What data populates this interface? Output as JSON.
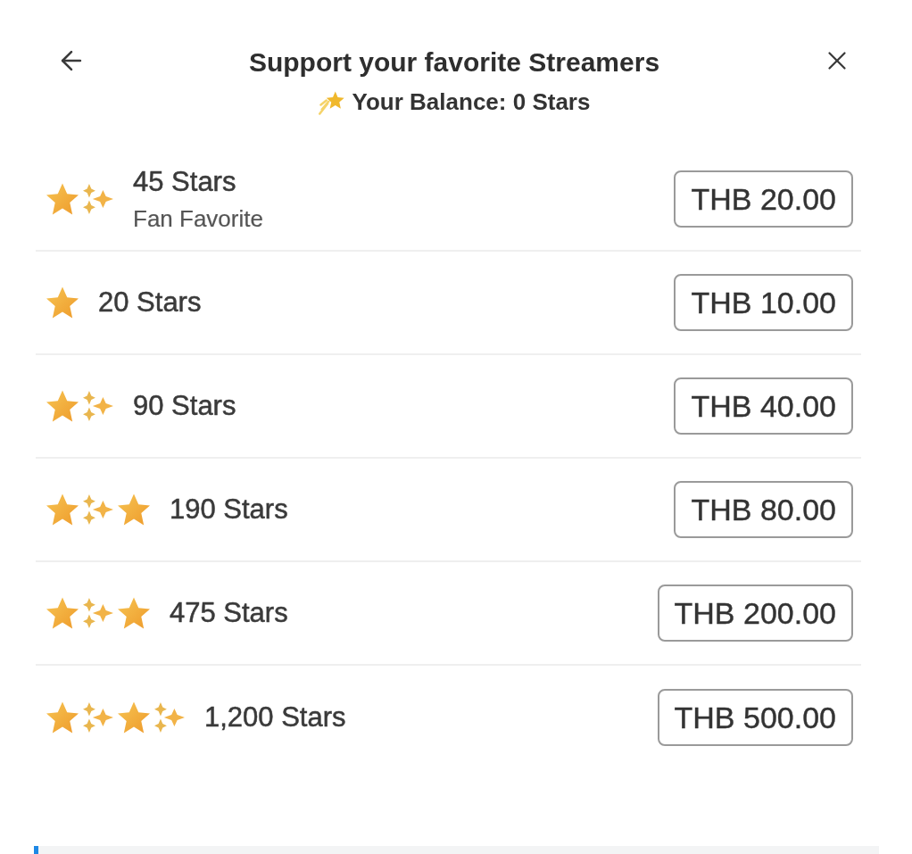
{
  "header": {
    "title": "Support your favorite Streamers",
    "balance": "Your Balance: 0 Stars"
  },
  "packages": [
    {
      "label": "45 Stars",
      "subtitle": "Fan Favorite",
      "price": "THB 20.00",
      "icons": [
        {
          "kind": "star"
        },
        {
          "kind": "sparkle"
        }
      ]
    },
    {
      "label": "20 Stars",
      "price": "THB 10.00",
      "icons": [
        {
          "kind": "star"
        }
      ]
    },
    {
      "label": "90 Stars",
      "price": "THB 40.00",
      "icons": [
        {
          "kind": "star"
        },
        {
          "kind": "sparkle"
        }
      ]
    },
    {
      "label": "190 Stars",
      "price": "THB 80.00",
      "icons": [
        {
          "kind": "star"
        },
        {
          "kind": "sparkle"
        },
        {
          "kind": "star"
        }
      ]
    },
    {
      "label": "475 Stars",
      "price": "THB 200.00",
      "icons": [
        {
          "kind": "star"
        },
        {
          "kind": "sparkle"
        },
        {
          "kind": "star"
        }
      ]
    },
    {
      "label": "1,200 Stars",
      "price": "THB 500.00",
      "icons": [
        {
          "kind": "star"
        },
        {
          "kind": "sparkle"
        },
        {
          "kind": "star"
        },
        {
          "kind": "sparkle"
        }
      ]
    }
  ]
}
